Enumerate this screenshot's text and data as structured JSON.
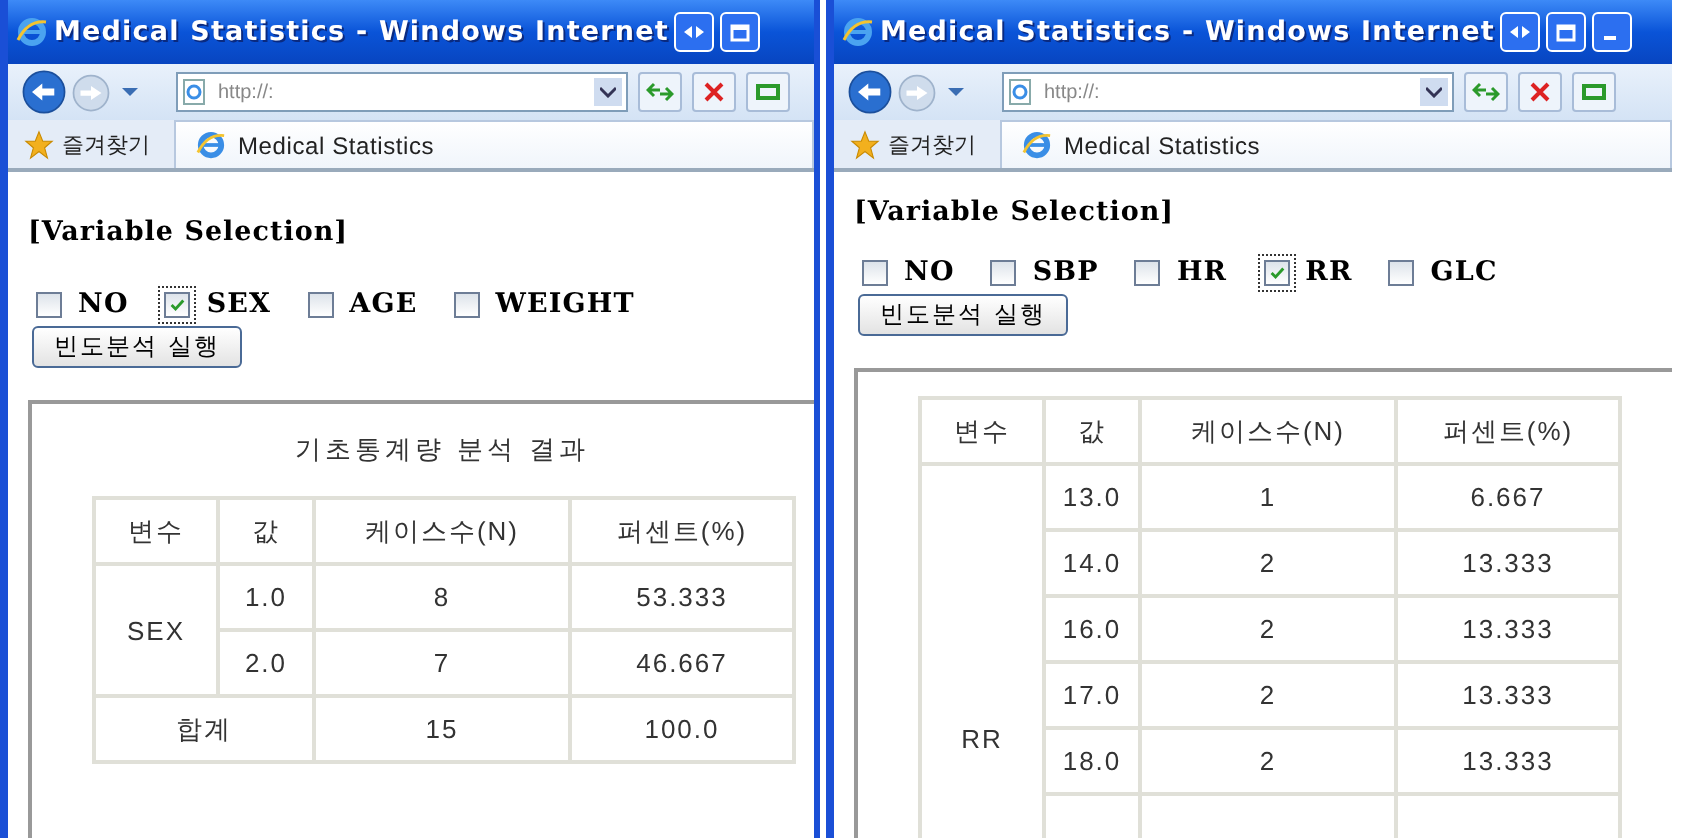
{
  "windows": [
    {
      "title": "Medical Statistics - Windows Internet",
      "address": "http://:",
      "favorites": "즐겨찾기",
      "tab": "Medical Statistics",
      "heading": "[Variable Selection]",
      "variables": [
        {
          "label": "NO",
          "checked": false
        },
        {
          "label": "SEX",
          "checked": true
        },
        {
          "label": "AGE",
          "checked": false
        },
        {
          "label": "WEIGHT",
          "checked": false
        }
      ],
      "run_button": "빈도분석 실행",
      "result": {
        "title": "기초통계량 분석 결과",
        "columns": [
          "변수",
          "값",
          "케이스수(N)",
          "퍼센트(%)"
        ],
        "groups": [
          {
            "variable": "SEX",
            "rows": [
              {
                "value": "1.0",
                "count": "8",
                "percent": "53.333"
              },
              {
                "value": "2.0",
                "count": "7",
                "percent": "46.667"
              }
            ]
          }
        ],
        "total": {
          "label": "합계",
          "count": "15",
          "percent": "100.0"
        }
      }
    },
    {
      "title": "Medical Statistics - Windows Internet",
      "address": "http://:",
      "favorites": "즐겨찾기",
      "tab": "Medical Statistics",
      "heading": "[Variable Selection]",
      "variables": [
        {
          "label": "NO",
          "checked": false
        },
        {
          "label": "SBP",
          "checked": false
        },
        {
          "label": "HR",
          "checked": false
        },
        {
          "label": "RR",
          "checked": true
        },
        {
          "label": "GLC",
          "checked": false
        }
      ],
      "run_button": "빈도분석 실행",
      "result": {
        "columns": [
          "변수",
          "값",
          "케이스수(N)",
          "퍼센트(%)"
        ],
        "groups": [
          {
            "variable": "RR",
            "rows": [
              {
                "value": "13.0",
                "count": "1",
                "percent": "6.667"
              },
              {
                "value": "14.0",
                "count": "2",
                "percent": "13.333"
              },
              {
                "value": "16.0",
                "count": "2",
                "percent": "13.333"
              },
              {
                "value": "17.0",
                "count": "2",
                "percent": "13.333"
              },
              {
                "value": "18.0",
                "count": "2",
                "percent": "13.333"
              }
            ]
          }
        ]
      }
    }
  ]
}
